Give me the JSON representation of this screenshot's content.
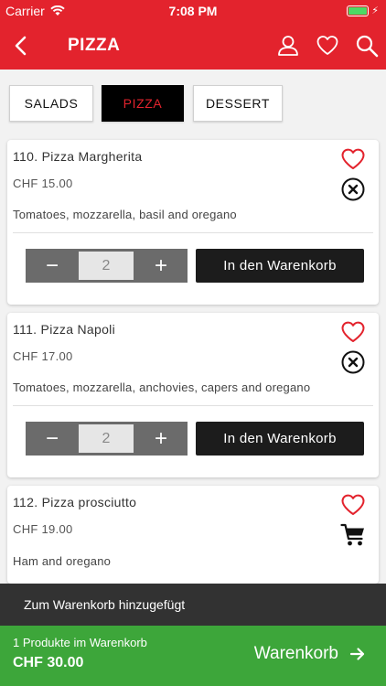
{
  "status": {
    "carrier": "Carrier",
    "time": "7:08 PM"
  },
  "nav": {
    "title": "PIZZA"
  },
  "tabs": [
    {
      "label": "SALADS",
      "active": false
    },
    {
      "label": "PIZZA",
      "active": true
    },
    {
      "label": "DESSERT",
      "active": false
    }
  ],
  "products": [
    {
      "name": "110. Pizza Margherita",
      "price": "CHF 15.00",
      "description": "Tomatoes, mozzarella, basil and oregano",
      "quantity": "2",
      "add_label": "In den Warenkorb"
    },
    {
      "name": "111. Pizza Napoli",
      "price": "CHF 17.00",
      "description": "Tomatoes, mozzarella, anchovies, capers and oregano",
      "quantity": "2",
      "add_label": "In den Warenkorb"
    },
    {
      "name": "112. Pizza prosciutto",
      "price": "CHF 19.00",
      "description": "Ham and oregano"
    }
  ],
  "toast": {
    "message": "Zum Warenkorb hinzugefügt"
  },
  "cart": {
    "count_text": "1 Produkte im Warenkorb",
    "total": "CHF 30.00",
    "button_label": "Warenkorb"
  },
  "colors": {
    "brand_red": "#e3232d",
    "cart_green": "#3da63a",
    "dark": "#1c1c1c"
  }
}
